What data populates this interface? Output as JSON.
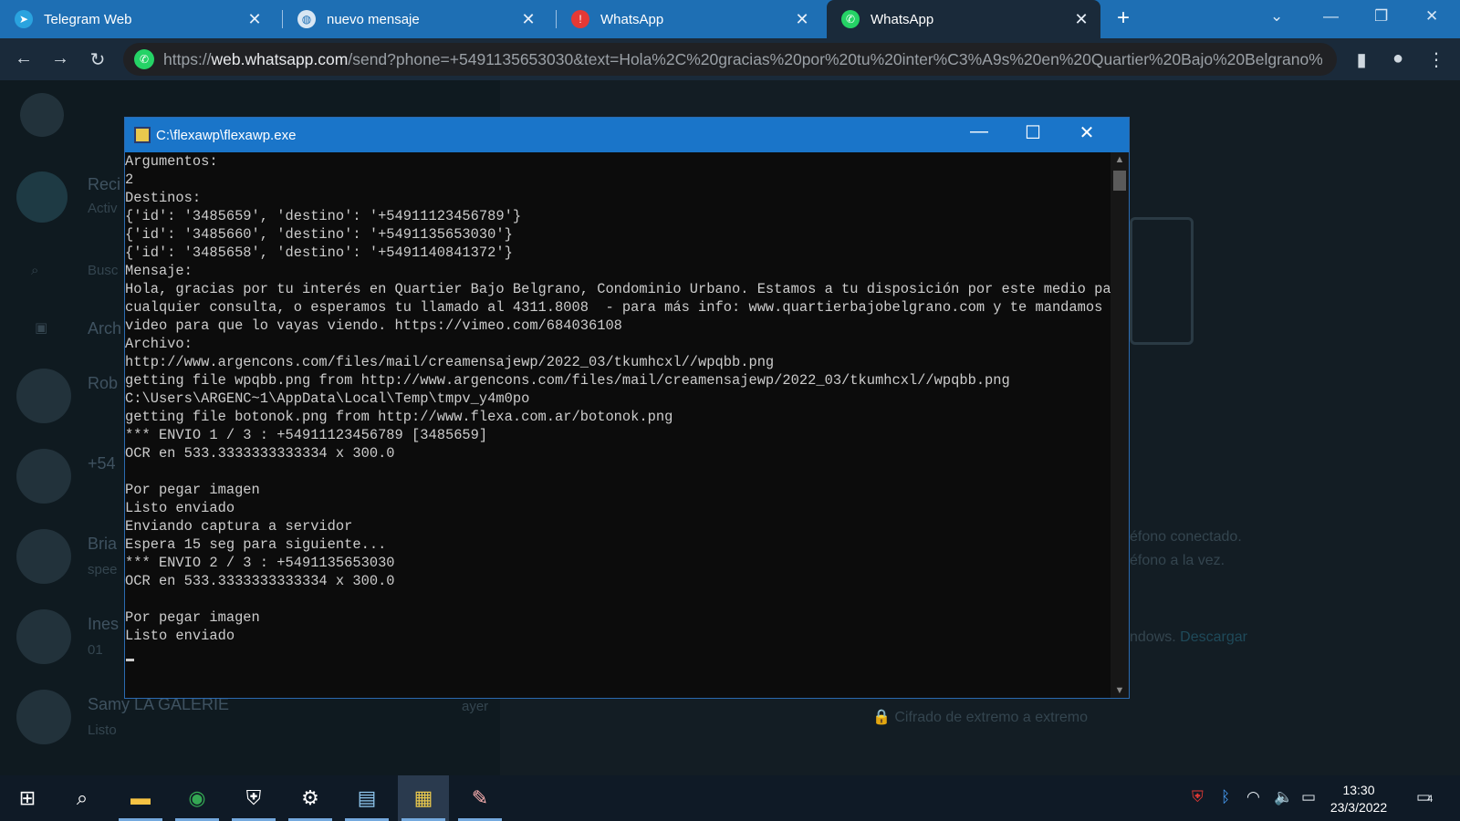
{
  "browser": {
    "tabs": [
      {
        "label": "Telegram Web",
        "icon": "telegram-icon",
        "color": "#2aa3df"
      },
      {
        "label": "nuevo mensaje",
        "icon": "globe-icon",
        "color": "#ffffff"
      },
      {
        "label": "WhatsApp",
        "icon": "alert-icon",
        "color": "#e53935"
      },
      {
        "label": "WhatsApp",
        "icon": "whatsapp-icon",
        "color": "#25d366"
      }
    ],
    "url_prefix": "https://",
    "url_host": "web.whatsapp.com",
    "url_rest": "/send?phone=+5491135653030&text=Hola%2C%20gracias%20por%20tu%20inter%C3%A9s%20en%20Quartier%20Bajo%20Belgrano%..."
  },
  "whatsapp_background": {
    "chats": [
      {
        "name": "Reci",
        "sub": "Activ"
      },
      {
        "name": "Busc",
        "sub": ""
      },
      {
        "name": "Arch",
        "sub": ""
      },
      {
        "name": "Rob",
        "sub": ""
      },
      {
        "name": "+54",
        "sub": ""
      },
      {
        "name": "Bria",
        "sub": "spee"
      },
      {
        "name": "Ines",
        "sub": "01"
      },
      {
        "name": "Samy LA GALERIE",
        "sub": "Listo",
        "time": "ayer"
      }
    ],
    "right_text_1": "éfono conectado.",
    "right_text_2": "éfono a la vez.",
    "right_text_3": "ndows.",
    "right_link": "Descargar",
    "encryption": "Cifrado de extremo a extremo"
  },
  "console": {
    "title": "C:\\flexawp\\flexawp.exe",
    "lines": [
      "Argumentos:",
      "2",
      "Destinos:",
      "{'id': '3485659', 'destino': '+54911123456789'}",
      "{'id': '3485660', 'destino': '+5491135653030'}",
      "{'id': '3485658', 'destino': '+5491140841372'}",
      "Mensaje:",
      "Hola, gracias por tu interés en Quartier Bajo Belgrano, Condominio Urbano. Estamos a tu disposición por este medio para",
      "cualquier consulta, o esperamos tu llamado al 4311.8008  - para más info: www.quartierbajobelgrano.com y te mandamos el",
      "video para que lo vayas viendo. https://vimeo.com/684036108",
      "Archivo:",
      "http://www.argencons.com/files/mail/creamensajewp/2022_03/tkumhcxl//wpqbb.png",
      "getting file wpqbb.png from http://www.argencons.com/files/mail/creamensajewp/2022_03/tkumhcxl//wpqbb.png",
      "C:\\Users\\ARGENC~1\\AppData\\Local\\Temp\\tmpv_y4m0po",
      "getting file botonok.png from http://www.flexa.com.ar/botonok.png",
      "*** ENVIO 1 / 3 : +54911123456789 [3485659]",
      "OCR en 533.3333333333334 x 300.0",
      "",
      "Por pegar imagen",
      "Listo enviado",
      "Enviando captura a servidor",
      "Espera 15 seg para siguiente...",
      "*** ENVIO 2 / 3 : +5491135653030",
      "OCR en 533.3333333333334 x 300.0",
      "",
      "Por pegar imagen",
      "Listo enviado"
    ]
  },
  "taskbar": {
    "time": "13:30",
    "date": "23/3/2022",
    "notifications": "4"
  }
}
